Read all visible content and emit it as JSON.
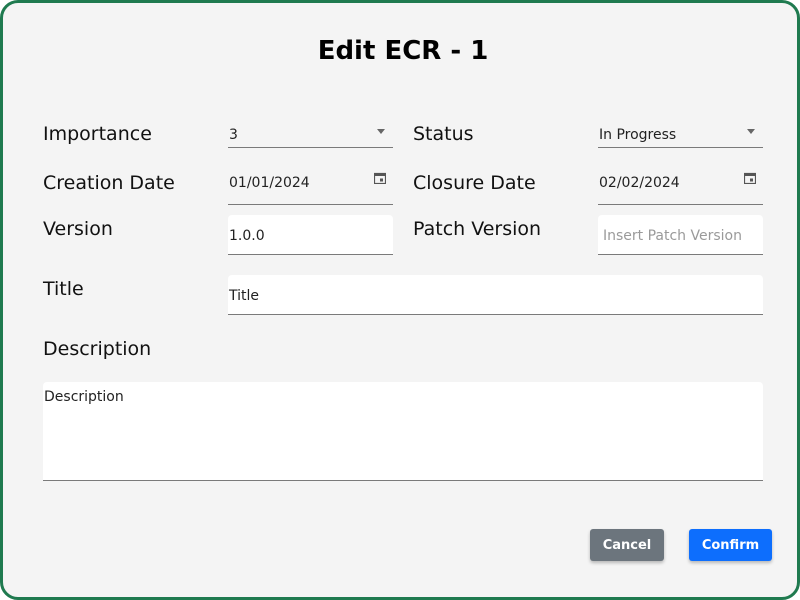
{
  "dialog": {
    "title": "Edit ECR - 1",
    "colors": {
      "border": "#1f7a4f",
      "confirm": "#0d6efd",
      "cancel": "#6c757d"
    }
  },
  "fields": {
    "importance": {
      "label": "Importance",
      "value": "3",
      "icon": "chevron-down-icon"
    },
    "status": {
      "label": "Status",
      "value": "In Progress",
      "icon": "chevron-down-icon"
    },
    "creation_date": {
      "label": "Creation Date",
      "value": "01/01/2024",
      "icon": "calendar-icon"
    },
    "closure_date": {
      "label": "Closure Date",
      "value": "02/02/2024",
      "icon": "calendar-icon"
    },
    "version": {
      "label": "Version",
      "value": "1.0.0"
    },
    "patch_version": {
      "label": "Patch Version",
      "value": "",
      "placeholder": "Insert Patch Version"
    },
    "title": {
      "label": "Title",
      "value": "Title"
    },
    "description": {
      "label": "Description",
      "value": "Description"
    }
  },
  "buttons": {
    "cancel": "Cancel",
    "confirm": "Confirm"
  }
}
